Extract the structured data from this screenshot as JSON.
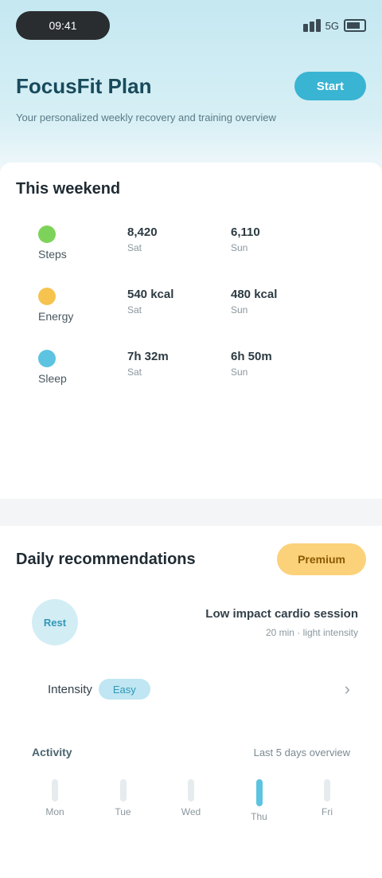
{
  "status": {
    "pill": "09:41",
    "right": "5G"
  },
  "hero": {
    "title": "FocusFit Plan",
    "button": "Start",
    "subtitle": "Your personalized weekly recovery and training overview"
  },
  "weekly": {
    "title": "This weekend",
    "metrics": [
      {
        "label": "Steps",
        "color": "#7dd35a",
        "cells": [
          {
            "val": "8,420",
            "sub": "Sat"
          },
          {
            "val": "6,110",
            "sub": "Sun"
          }
        ]
      },
      {
        "label": "Energy",
        "color": "#f6c34f",
        "cells": [
          {
            "val": "540 kcal",
            "sub": "Sat"
          },
          {
            "val": "480 kcal",
            "sub": "Sun"
          }
        ]
      },
      {
        "label": "Sleep",
        "color": "#5cc4e0",
        "cells": [
          {
            "val": "7h 32m",
            "sub": "Sat"
          },
          {
            "val": "6h 50m",
            "sub": "Sun"
          }
        ]
      }
    ]
  },
  "rec": {
    "title": "Daily recommendations",
    "badge": "Premium",
    "circle": "Rest",
    "info_l1": "Low impact cardio session",
    "info_l2": "20 min · light intensity",
    "tag_label": "Intensity",
    "tag": "Easy",
    "chevron": "›",
    "row3_label": "Activity",
    "row3_right": "Last 5 days overview",
    "days": [
      "Mon",
      "Tue",
      "Wed",
      "Thu",
      "Fri"
    ],
    "active_day_index": 3
  }
}
